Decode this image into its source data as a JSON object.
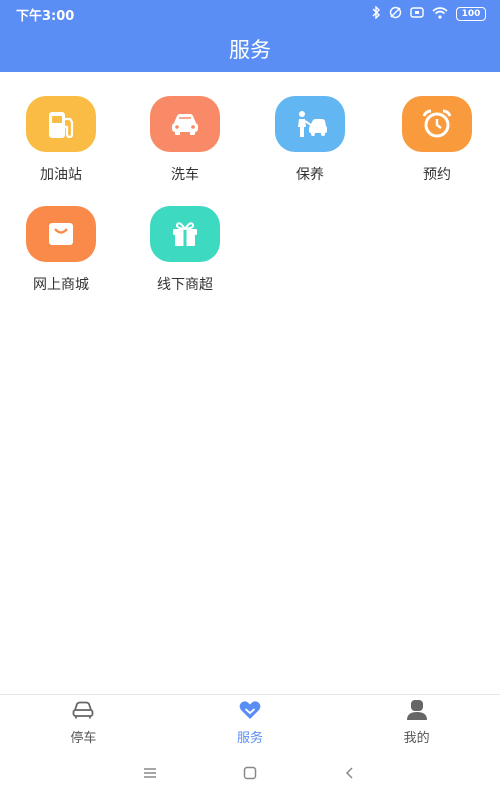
{
  "status_bar": {
    "time": "下午3:00",
    "battery": "100"
  },
  "header": {
    "title": "服务"
  },
  "services": [
    {
      "label": "加油站",
      "icon": "fuel-pump-icon",
      "color": "#fbbc45"
    },
    {
      "label": "洗车",
      "icon": "car-icon",
      "color": "#f98a67"
    },
    {
      "label": "保养",
      "icon": "car-maintenance-icon",
      "color": "#62b7f2"
    },
    {
      "label": "预约",
      "icon": "alarm-clock-icon",
      "color": "#f99a3c"
    },
    {
      "label": "网上商城",
      "icon": "shopping-bag-icon",
      "color": "#f98a4a"
    },
    {
      "label": "线下商超",
      "icon": "gift-icon",
      "color": "#3dd9c0"
    }
  ],
  "bottom_nav": {
    "items": [
      {
        "label": "停车",
        "icon": "car-outline-icon"
      },
      {
        "label": "服务",
        "icon": "heart-icon",
        "active": true
      },
      {
        "label": "我的",
        "icon": "user-icon"
      }
    ],
    "active_color": "#5b8ef5"
  },
  "colors": {
    "header": "#5b8ef5"
  }
}
